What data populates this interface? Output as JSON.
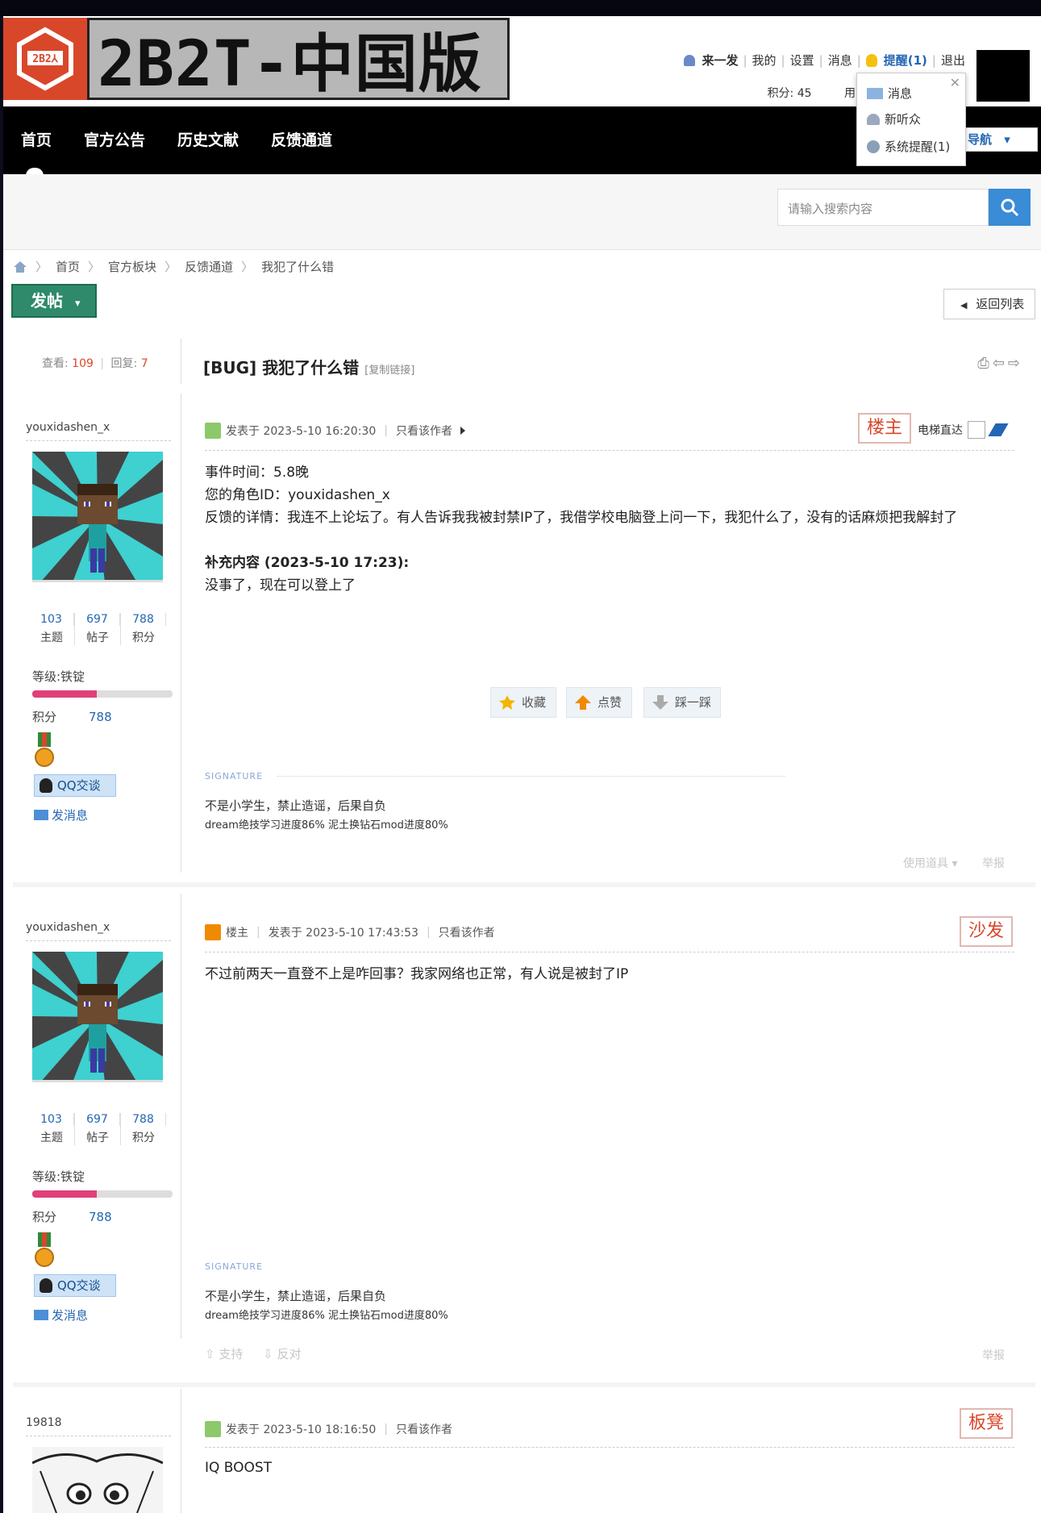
{
  "site": {
    "logo_text": "2B2T-中国版",
    "logo_badge": "2B2⅄"
  },
  "userbar": {
    "username": "来一发",
    "mine": "我的",
    "settings": "设置",
    "messages": "消息",
    "remind": "提醒(1)",
    "logout": "退出",
    "score_label": "积分: 45",
    "partial": "用"
  },
  "dropdown": {
    "items": [
      "消息",
      "新听众",
      "系统提醒(1)"
    ]
  },
  "nav": {
    "items": [
      "首页",
      "官方公告",
      "历史文献",
      "反馈通道"
    ],
    "guide": "导航"
  },
  "search": {
    "placeholder": "请输入搜索内容"
  },
  "breadcrumb": [
    "首页",
    "官方板块",
    "反馈通道",
    "我犯了什么错"
  ],
  "buttons": {
    "post": "发帖",
    "back": "返回列表"
  },
  "thread": {
    "views_label": "查看:",
    "views": "109",
    "replies_label": "回复:",
    "replies": "7",
    "title": "[BUG] 我犯了什么错",
    "copy_link": "[复制链接]"
  },
  "posts": [
    {
      "author": "youxidashen_x",
      "stats": [
        {
          "n": "103",
          "l": "主题"
        },
        {
          "n": "697",
          "l": "帖子"
        },
        {
          "n": "788",
          "l": "积分"
        }
      ],
      "level": "等级:铁锭",
      "level_progress": 0.46,
      "points_label": "积分",
      "points": "788",
      "qq": "QQ交谈",
      "send": "发消息",
      "meta_time": "发表于 2023-5-10 16:20:30",
      "only_author": "只看该作者",
      "floor": "楼主",
      "elevator": "电梯直达",
      "lines": [
        "事件时间：5.8晚",
        "您的角色ID：youxidashen_x",
        "反馈的详情：我连不上论坛了。有人告诉我我被封禁IP了，我借学校电脑登上问一下，我犯什么了，没有的话麻烦把我解封了"
      ],
      "supp_head": "补充内容 (2023-5-10 17:23):",
      "supp_body": "没事了，现在可以登上了",
      "actions": [
        "收藏",
        "点赞",
        "踩一踩"
      ],
      "sig_label": "SIGNATURE",
      "sig1": "不是小学生，禁止造谣，后果自负",
      "sig2": "dream绝技学习进度86% 泥土换钻石mod进度80%",
      "footer": [
        "使用道具",
        "举报"
      ]
    },
    {
      "author": "youxidashen_x",
      "stats": [
        {
          "n": "103",
          "l": "主题"
        },
        {
          "n": "697",
          "l": "帖子"
        },
        {
          "n": "788",
          "l": "积分"
        }
      ],
      "level": "等级:铁锭",
      "level_progress": 0.46,
      "points_label": "积分",
      "points": "788",
      "qq": "QQ交谈",
      "send": "发消息",
      "role": "楼主",
      "meta_time": "发表于 2023-5-10 17:43:53",
      "only_author": "只看该作者",
      "floor": "沙发",
      "body": "不过前两天一直登不上是咋回事？我家网络也正常，有人说是被封了IP",
      "sig_label": "SIGNATURE",
      "sig1": "不是小学生，禁止造谣，后果自负",
      "sig2": "dream绝技学习进度86% 泥土换钻石mod进度80%",
      "support": "支持",
      "oppose": "反对",
      "report": "举报"
    },
    {
      "author": "19818",
      "meta_time": "发表于 2023-5-10 18:16:50",
      "only_author": "只看该作者",
      "floor": "板凳",
      "body": "IQ BOOST"
    }
  ],
  "colors": {
    "accent": "#2466b4",
    "brand_red": "#d9472b",
    "nav_bg": "#000000",
    "post_btn": "#2e8a6a"
  }
}
